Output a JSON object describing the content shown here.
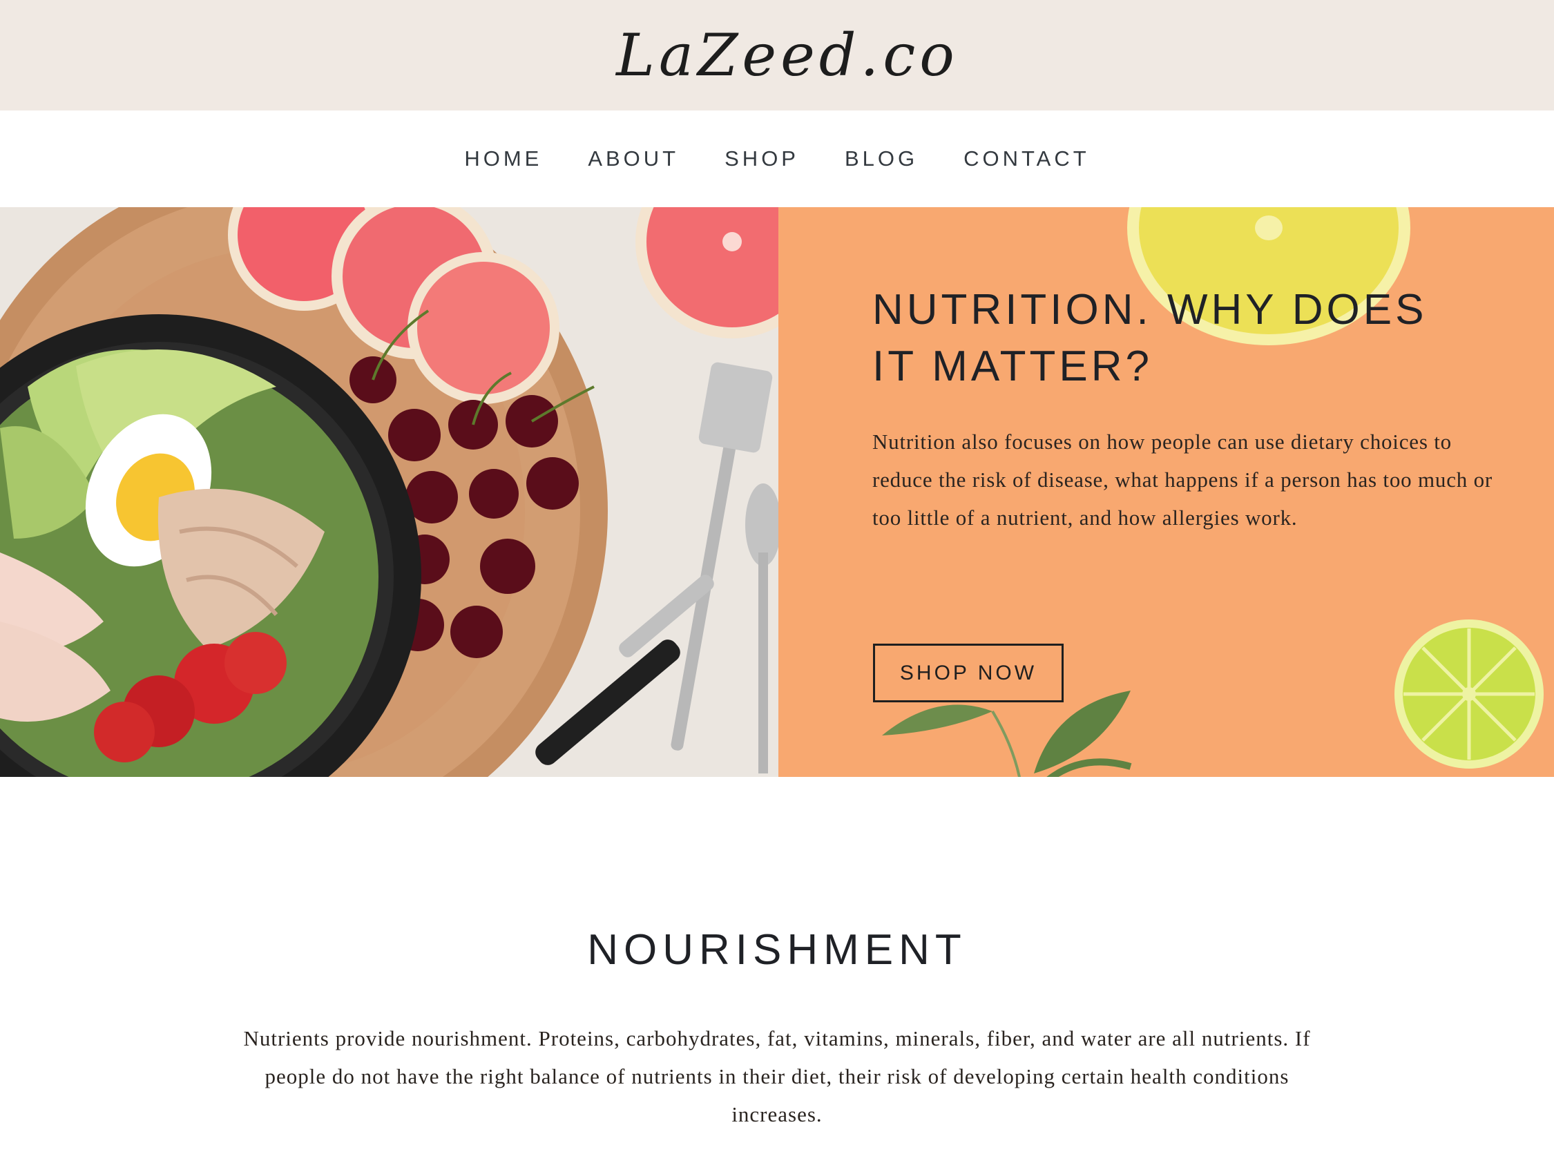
{
  "brand": {
    "logo_text": "LaZeed.co"
  },
  "nav": {
    "items": [
      {
        "label": "HOME"
      },
      {
        "label": "ABOUT"
      },
      {
        "label": "SHOP"
      },
      {
        "label": "BLOG"
      },
      {
        "label": "CONTACT"
      }
    ]
  },
  "hero": {
    "title": "NUTRITION. WHY DOES IT MATTER?",
    "text": "Nutrition also focuses on how people can use dietary choices to reduce the risk of disease, what happens if a person has too much or too little of a nutrient, and how allergies work.",
    "button_label": "SHOP NOW",
    "panel_color": "#f8a870",
    "image_icons": [
      "salad-bowl-icon",
      "grapefruit-icon",
      "cherries-icon",
      "fork-icon",
      "knife-icon",
      "spoon-icon"
    ],
    "decor_icons": [
      "lemon-slice-icon",
      "lime-slice-icon",
      "leaf-sprig-icon"
    ]
  },
  "nourishment": {
    "title": "NOURISHMENT",
    "text": "Nutrients provide nourishment. Proteins, carbohydrates, fat, vitamins, minerals, fiber, and water are all nutrients. If people do not have the right balance of nutrients in their diet, their risk of developing certain health conditions increases."
  },
  "colors": {
    "brand_bar": "#f0e9e3",
    "text_dark": "#1f2126",
    "accent_orange": "#f8a870"
  }
}
